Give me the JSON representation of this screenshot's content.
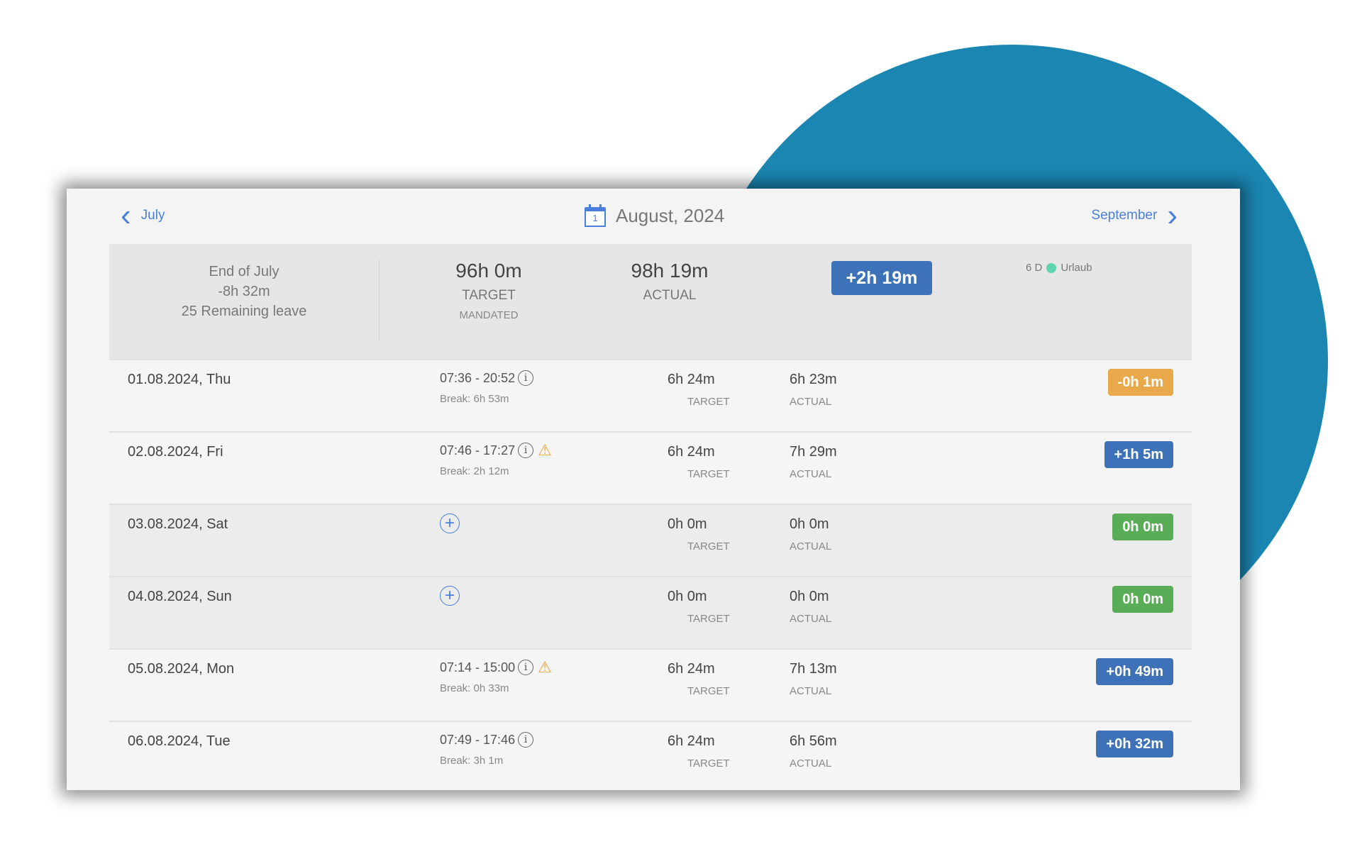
{
  "nav": {
    "prev_label": "July",
    "next_label": "September",
    "title": "August, 2024",
    "calendar_day": "1"
  },
  "summary": {
    "end_of_label": "End of July",
    "end_of_balance": "-8h 32m",
    "remaining_leave": "25 Remaining leave",
    "target_value": "96h 0m",
    "target_label": "TARGET",
    "target_sub": "MANDATED",
    "actual_value": "98h 19m",
    "actual_label": "ACTUAL",
    "balance_badge": "+2h 19m",
    "leave_days": "6 D",
    "leave_type": "Urlaub"
  },
  "rows": [
    {
      "date": "01.08.2024, Thu",
      "time": "07:36 - 20:52",
      "break": "Break: 6h 53m",
      "target": "6h 24m",
      "target_label": "TARGET",
      "actual": "6h 23m",
      "actual_label": "ACTUAL",
      "balance": "-0h 1m"
    },
    {
      "date": "02.08.2024, Fri",
      "time": "07:46 - 17:27",
      "break": "Break: 2h 12m",
      "target": "6h 24m",
      "target_label": "TARGET",
      "actual": "7h 29m",
      "actual_label": "ACTUAL",
      "balance": "+1h 5m"
    },
    {
      "date": "03.08.2024, Sat",
      "target": "0h 0m",
      "target_label": "TARGET",
      "actual": "0h 0m",
      "actual_label": "ACTUAL",
      "balance": "0h 0m"
    },
    {
      "date": "04.08.2024, Sun",
      "target": "0h 0m",
      "target_label": "TARGET",
      "actual": "0h 0m",
      "actual_label": "ACTUAL",
      "balance": "0h 0m"
    },
    {
      "date": "05.08.2024, Mon",
      "time": "07:14 - 15:00",
      "break": "Break: 0h 33m",
      "target": "6h 24m",
      "target_label": "TARGET",
      "actual": "7h 13m",
      "actual_label": "ACTUAL",
      "balance": "+0h 49m"
    },
    {
      "date": "06.08.2024, Tue",
      "time": "07:49 - 17:46",
      "break": "Break: 3h 1m",
      "target": "6h 24m",
      "target_label": "TARGET",
      "actual": "6h 56m",
      "actual_label": "ACTUAL",
      "balance": "+0h 32m"
    }
  ],
  "colors": {
    "accent_blue": "#4a7fe0",
    "badge_positive": "#3d72b8",
    "badge_negative": "#e9a94a",
    "badge_zero": "#5aad57",
    "decor_circle": "#1b86b2",
    "leave_dot": "#5ed3b0"
  },
  "icons": {
    "prev": "chevron-left-icon",
    "next": "chevron-right-icon",
    "calendar": "calendar-icon",
    "info": "info-icon",
    "warning": "warning-icon",
    "add": "plus-circle-icon"
  }
}
